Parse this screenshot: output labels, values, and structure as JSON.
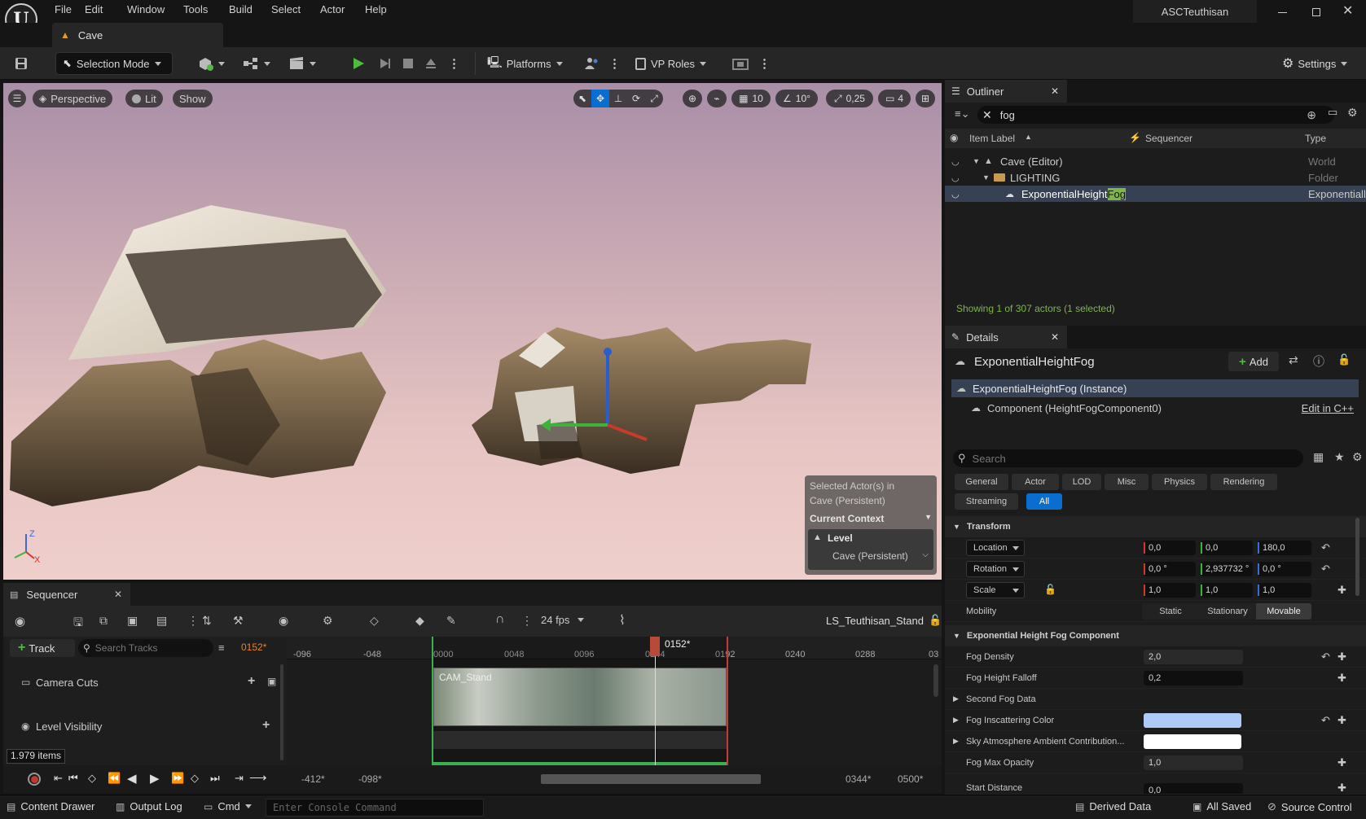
{
  "menu": [
    "File",
    "Edit",
    "Window",
    "Tools",
    "Build",
    "Select",
    "Actor",
    "Help"
  ],
  "project": "ASCTeuthisan",
  "level_tab": "Cave",
  "toolbar": {
    "selection_mode": "Selection Mode",
    "platforms": "Platforms",
    "vp_roles": "VP Roles",
    "settings": "Settings"
  },
  "viewport": {
    "perspective": "Perspective",
    "lit": "Lit",
    "show": "Show",
    "grid_snap": "10",
    "angle_snap": "10°",
    "scale_snap": "0,25",
    "camera_speed": "4",
    "context": {
      "selected_line1": "Selected Actor(s) in",
      "selected_line2": "Cave (Persistent)",
      "current_context": "Current Context",
      "level": "Level",
      "level_name": "Cave (Persistent)"
    },
    "axis_z": "Z",
    "axis_x": "X"
  },
  "sequencer": {
    "tab": "Sequencer",
    "fps": "24 fps",
    "sequence_name": "LS_Teuthisan_Stand",
    "add_track": "Track",
    "search_placeholder": "Search Tracks",
    "current_frame": "0152*",
    "playhead_label": "0152*",
    "ticks": [
      "-096",
      "-048",
      "0000",
      "0048",
      "0096",
      "0144",
      "0192",
      "0240",
      "0288",
      "03"
    ],
    "tracks": [
      "Camera Cuts",
      "Level Visibility"
    ],
    "clip_label": "CAM_Stand",
    "items_count": "1.979 items",
    "range_start": "-412*",
    "view_start": "-098*",
    "view_end": "0344*",
    "range_end": "0500*"
  },
  "statusbar": {
    "content_drawer": "Content Drawer",
    "output_log": "Output Log",
    "cmd": "Cmd",
    "console_placeholder": "Enter Console Command",
    "derived_data": "Derived Data",
    "all_saved": "All Saved",
    "source_control": "Source Control"
  },
  "outliner": {
    "title": "Outliner",
    "filter": "fog",
    "columns": [
      "Item Label",
      "Sequencer",
      "Type"
    ],
    "rows": [
      {
        "label": "Cave (Editor)",
        "type": "World"
      },
      {
        "label": "LIGHTING",
        "type": "Folder"
      },
      {
        "label_prefix": "ExponentialHeight",
        "label_highlight": "Fog",
        "type": "Exponentiall"
      }
    ],
    "summary": "Showing 1 of 307 actors (1 selected)"
  },
  "details": {
    "title": "Details",
    "actor_name": "ExponentialHeightFog",
    "add": "Add",
    "instance": "ExponentialHeightFog (Instance)",
    "component": "Component (HeightFogComponent0)",
    "edit_cpp": "Edit in C++",
    "search_placeholder": "Search",
    "filters": [
      "General",
      "Actor",
      "LOD",
      "Misc",
      "Physics",
      "Rendering",
      "Streaming",
      "All"
    ],
    "transform": {
      "header": "Transform",
      "location": {
        "label": "Location",
        "x": "0,0",
        "y": "0,0",
        "z": "180,0"
      },
      "rotation": {
        "label": "Rotation",
        "x": "0,0 °",
        "y": "2,937732 °",
        "z": "0,0 °"
      },
      "scale": {
        "label": "Scale",
        "x": "1,0",
        "y": "1,0",
        "z": "1,0"
      },
      "mobility": {
        "label": "Mobility",
        "options": [
          "Static",
          "Stationary",
          "Movable"
        ],
        "selected": "Movable"
      }
    },
    "fog": {
      "header": "Exponential Height Fog Component",
      "density": {
        "label": "Fog Density",
        "value": "2,0"
      },
      "falloff": {
        "label": "Fog Height Falloff",
        "value": "0,2"
      },
      "second": "Second Fog Data",
      "inscatter": {
        "label": "Fog Inscattering Color",
        "color": "#aecbf7"
      },
      "sky": {
        "label": "Sky Atmosphere Ambient Contribution...",
        "color": "#ffffff"
      },
      "max_opacity": {
        "label": "Fog Max Opacity",
        "value": "1,0"
      },
      "start": {
        "label": "Start Distance",
        "value": "0,0"
      }
    }
  },
  "colors": {
    "accent": "#0a6ed1",
    "selected_row": "#364154",
    "green_text": "#7fb64b",
    "play_green": "#4fbc3f",
    "record_red": "#c0392b"
  }
}
